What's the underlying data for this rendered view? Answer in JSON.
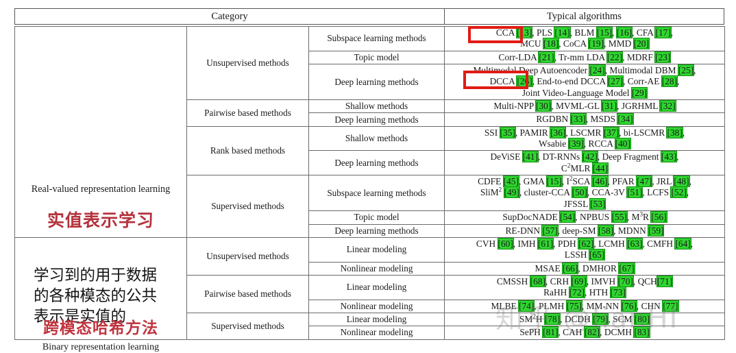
{
  "header": {
    "category_label": "Category",
    "algorithms_label": "Typical algorithms"
  },
  "sections": [
    {
      "name_en": "Real-valued representation learning",
      "name_cn_red": "实值表示学习",
      "note_cn": "学习到的用于数据\n的各种模态的公共\n表示是实值的"
    },
    {
      "name_cn_red": "跨模态哈希方法",
      "name_en": "Binary representation learning"
    }
  ],
  "groups": {
    "unsupervised": "Unsupervised methods",
    "pairwise": "Pairwise based methods",
    "rank": "Rank based methods",
    "supervised": "Supervised methods"
  },
  "subtypes": {
    "subspace": "Subspace learning methods",
    "topic": "Topic model",
    "deep": "Deep learning methods",
    "shallow": "Shallow methods",
    "linear": "Linear modeling",
    "nonlinear": "Nonlinear modeling"
  },
  "rows": [
    {
      "id": "r1",
      "algorithms_html": "CCA <span class=\"cit\">[13]</span>, PLS <span class=\"cit\">[14]</span>, BLM <span class=\"cit\">[15]</span>, <span class=\"cit\">[16]</span>, CFA <span class=\"cit\">[17]</span>,<br>MCU <span class=\"cit\">[18]</span>, CoCA <span class=\"cit\">[19]</span>, MMD <span class=\"cit\">[20]</span>"
    },
    {
      "id": "r2",
      "algorithms_html": "Corr-LDA <span class=\"cit\">[21]</span>, Tr-mm LDA <span class=\"cit\">[22]</span>, MDRF <span class=\"cit\">[23]</span>"
    },
    {
      "id": "r3",
      "algorithms_html": "Multimodal Deep Autoencoder <span class=\"cit\">[24]</span>, Multimodal DBM <span class=\"cit\">[25]</span>,<br>DCCA <span class=\"cit\">[26]</span>, End-to-end DCCA <span class=\"cit\">[27]</span>, Corr-AE <span class=\"cit\">[28]</span>,<br>Joint Video-Language Model <span class=\"cit\">[29]</span>"
    },
    {
      "id": "r4",
      "algorithms_html": "Multi-NPP <span class=\"cit\">[30]</span>, MVML-GL <span class=\"cit\">[31]</span>, JGRHML <span class=\"cit\">[32]</span>"
    },
    {
      "id": "r5",
      "algorithms_html": "RGDBN <span class=\"cit\">[33]</span>, MSDS <span class=\"cit\">[34]</span>"
    },
    {
      "id": "r6",
      "algorithms_html": "SSI <span class=\"cit\">[35]</span>, PAMIR <span class=\"cit\">[36]</span>, LSCMR <span class=\"cit\">[37]</span>, bi-LSCMR <span class=\"cit\">[38]</span>,<br>Wsabie <span class=\"cit\">[39]</span>, RCCA <span class=\"cit\">[40]</span>"
    },
    {
      "id": "r7",
      "algorithms_html": "DeViSE <span class=\"cit\">[41]</span>, DT-RNNs <span class=\"cit\">[42]</span>, Deep Fragment <span class=\"cit\">[43]</span>,<br>C<sup>2</sup>MLR <span class=\"cit\">[44]</span>"
    },
    {
      "id": "r8",
      "algorithms_html": "CDFE <span class=\"cit\">[45]</span>, GMA <span class=\"cit\">[15]</span>, I<sup>2</sup>SCA <span class=\"cit\">[46]</span>, PFAR <span class=\"cit\">[47]</span>, JRL <span class=\"cit\">[48]</span>,<br>SliM<sup>2</sup> <span class=\"cit\">[49]</span>, cluster-CCA <span class=\"cit\">[50]</span>, CCA-3V <span class=\"cit\">[51]</span>, LCFS <span class=\"cit\">[52]</span>,<br>JFSSL <span class=\"cit\">[53]</span>"
    },
    {
      "id": "r9",
      "algorithms_html": "SupDocNADE <span class=\"cit\">[54]</span>, NPBUS <span class=\"cit\">[55]</span>, M<sup>3</sup>R <span class=\"cit\">[56]</span>"
    },
    {
      "id": "r10",
      "algorithms_html": "RE-DNN <span class=\"cit\">[57]</span>, deep-SM <span class=\"cit\">[58]</span>, MDNN <span class=\"cit\">[59]</span>"
    },
    {
      "id": "r11",
      "algorithms_html": "CVH <span class=\"cit\">[60]</span>, IMH <span class=\"cit\">[61]</span>, PDH <span class=\"cit\">[62]</span>, LCMH <span class=\"cit\">[63]</span>, CMFH <span class=\"cit\">[64]</span>,<br>LSSH <span class=\"cit\">[65]</span>"
    },
    {
      "id": "r12",
      "algorithms_html": "MSAE <span class=\"cit\">[66]</span>, DMHOR <span class=\"cit\">[67]</span>"
    },
    {
      "id": "r13",
      "algorithms_html": "CMSSH <span class=\"cit\">[68]</span>, CRH <span class=\"cit\">[69]</span>, IMVH <span class=\"cit\">[70]</span>, QCH<span class=\"cit\">[71]</span><br>RaHH <span class=\"cit\">[72]</span>, HTH <span class=\"cit\">[73]</span>"
    },
    {
      "id": "r14",
      "algorithms_html": "MLBE <span class=\"cit\">[74]</span>, PLMH <span class=\"cit\">[75]</span>, MM-NN <span class=\"cit\">[76]</span>, CHN <span class=\"cit\">[77]</span>"
    },
    {
      "id": "r15",
      "algorithms_html": "SM<sup>2</sup>H <span class=\"cit\">[78]</span>, DCDH <span class=\"cit\">[79]</span>, SCM <span class=\"cit\">[80]</span>"
    },
    {
      "id": "r16",
      "algorithms_html": "SePH <span class=\"cit\">[81]</span>, CAH <span class=\"cit\">[82]</span>, DCMH <span class=\"cit\">[83]</span>"
    }
  ],
  "annotations": {
    "red_box_1_target": "CCA [13]",
    "red_box_2_target": "DCCA [26]",
    "highlight_color": "#2fd62f",
    "red_color": "#e01b14",
    "red_text_color": "#b4323c"
  },
  "watermark": {
    "text": "知乎 @JianHI"
  }
}
